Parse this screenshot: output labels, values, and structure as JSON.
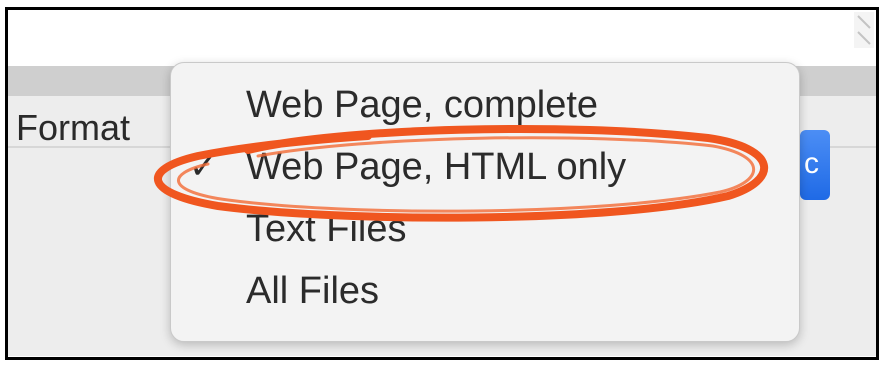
{
  "dialog": {
    "format_label": "Format",
    "format_menu": {
      "items": [
        {
          "label": "Web Page, complete",
          "checked": false
        },
        {
          "label": "Web Page, HTML only",
          "checked": true
        },
        {
          "label": "Text Files",
          "checked": false
        },
        {
          "label": "All Files",
          "checked": false
        }
      ],
      "check_glyph": "✓",
      "selected_index": 1
    },
    "button_partial_glyph": "c"
  },
  "annotation": {
    "type": "hand-drawn-ellipse",
    "color": "#f0561f",
    "target": "Web Page, HTML only"
  },
  "colors": {
    "menu_background": "#f3f3f3",
    "panel_background": "#ededed",
    "accent_blue": "#2a74ee"
  }
}
